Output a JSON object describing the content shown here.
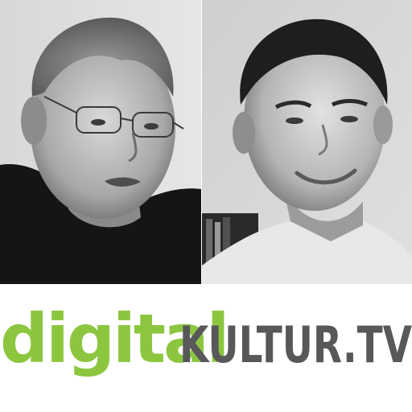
{
  "photos": [
    {
      "id": "left",
      "subject": "older man with glasses, gray hair, dark t-shirt",
      "tone": "grayscale"
    },
    {
      "id": "right",
      "subject": "younger man smiling, short dark hair, light shirt",
      "tone": "grayscale"
    }
  ],
  "logo": {
    "part1": "digital",
    "part2": "KULTUR.TV",
    "colors": {
      "part1": "#8cc63f",
      "part2": "#58585a"
    }
  }
}
